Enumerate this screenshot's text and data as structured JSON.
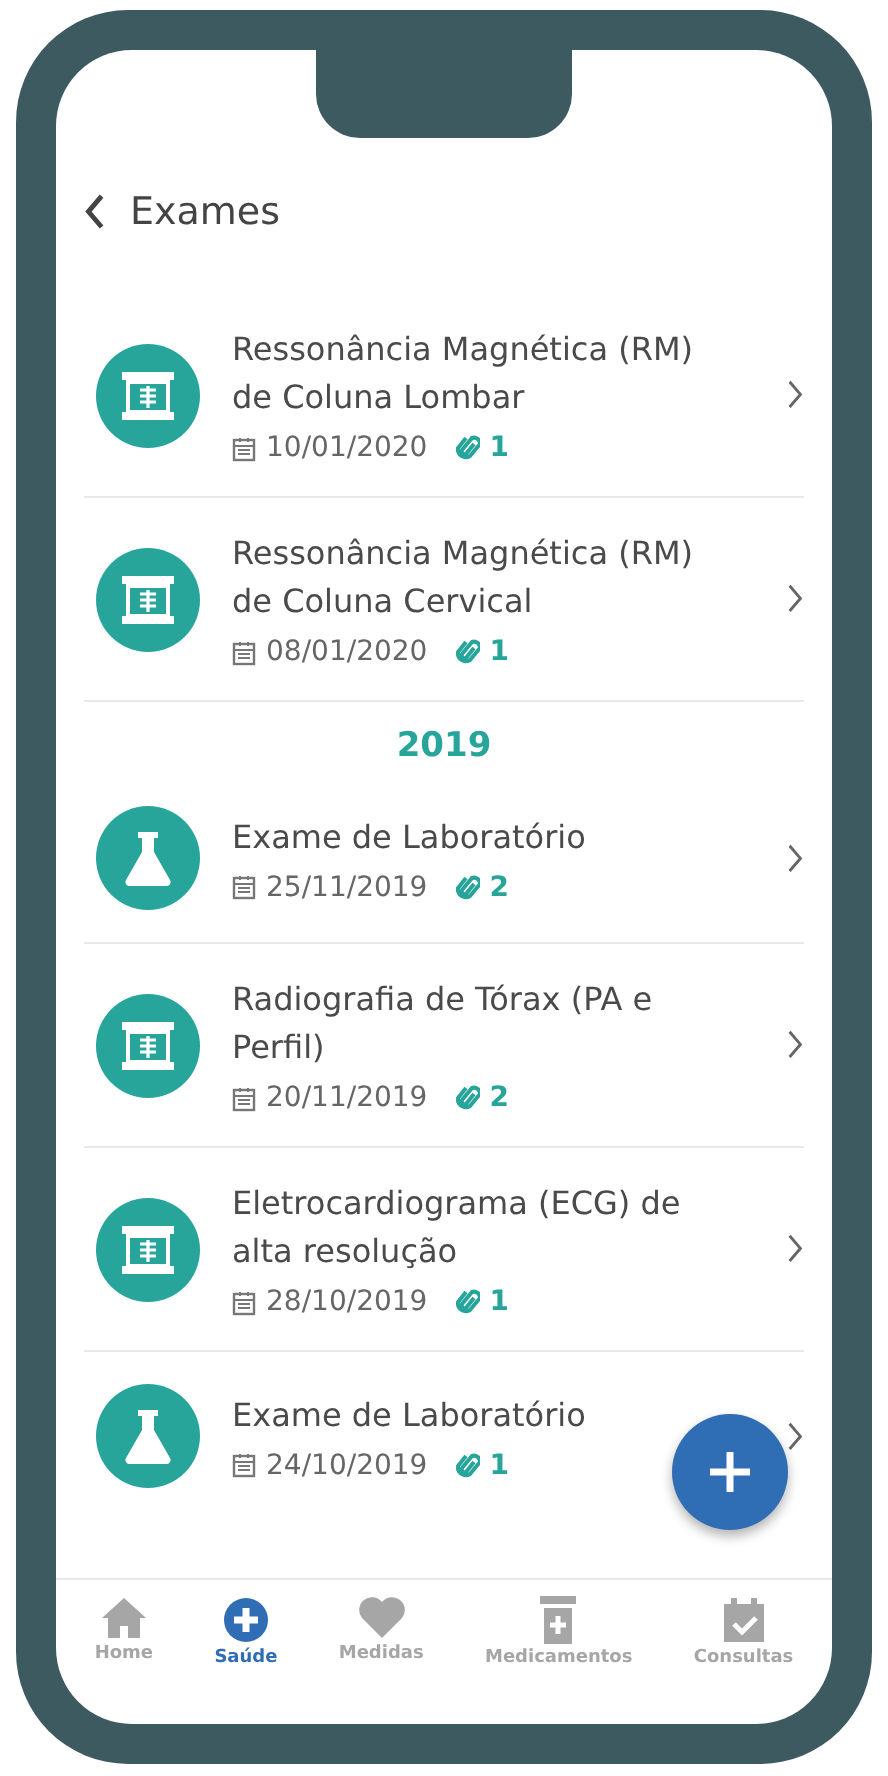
{
  "header": {
    "title": "Exames"
  },
  "sections": [
    {
      "items": [
        {
          "kind": "xray",
          "title": "Ressonância Magnética (RM) de Coluna Lombar",
          "date": "10/01/2020",
          "attachments": "1"
        },
        {
          "kind": "xray",
          "title": "Ressonância Magnética (RM) de Coluna Cervical",
          "date": "08/01/2020",
          "attachments": "1"
        }
      ]
    },
    {
      "year": "2019",
      "items": [
        {
          "kind": "lab",
          "title": "Exame de Laboratório",
          "date": "25/11/2019",
          "attachments": "2"
        },
        {
          "kind": "xray",
          "title": "Radiografia de Tórax (PA e Perfil)",
          "date": "20/11/2019",
          "attachments": "2"
        },
        {
          "kind": "xray",
          "title": "Eletrocardiograma (ECG) de alta resolução",
          "date": "28/10/2019",
          "attachments": "1"
        },
        {
          "kind": "lab",
          "title": "Exame de Laboratório",
          "date": "24/10/2019",
          "attachments": "1"
        }
      ]
    }
  ],
  "nav": [
    {
      "kind": "home",
      "label": "Home",
      "selected": false
    },
    {
      "kind": "health",
      "label": "Saúde",
      "selected": true
    },
    {
      "kind": "heart",
      "label": "Medidas",
      "selected": false
    },
    {
      "kind": "meds",
      "label": "Medicamentos",
      "selected": false
    },
    {
      "kind": "calendar",
      "label": "Consultas",
      "selected": false
    }
  ]
}
